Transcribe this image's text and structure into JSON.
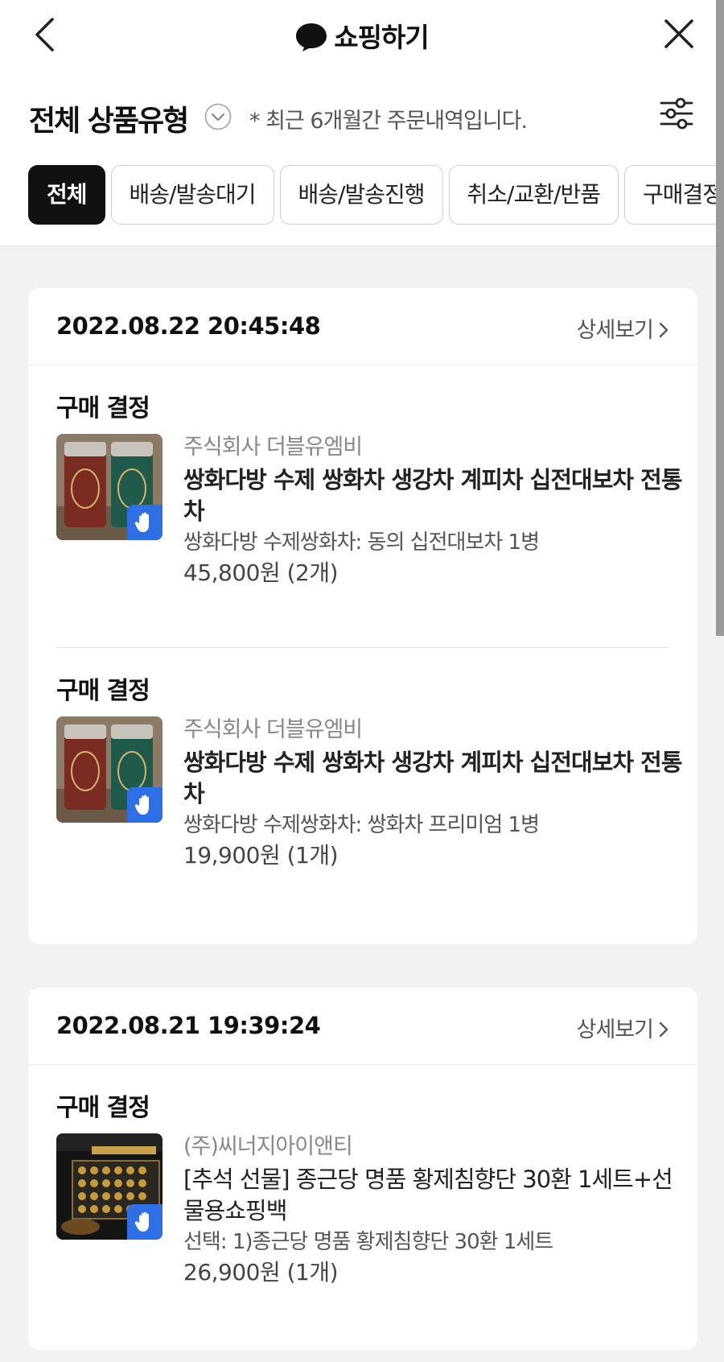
{
  "header": {
    "title": "쇼핑하기",
    "back_icon": "chevron-left-icon",
    "close_icon": "close-icon",
    "chat_icon": "speech-bubble-icon"
  },
  "filter": {
    "type_label": "전체 상품유형",
    "note": "* 최근 6개월간 주문내역입니다.",
    "settings_icon": "sliders-icon"
  },
  "chips": [
    "전체",
    "배송/발송대기",
    "배송/발송진행",
    "취소/교환/반품",
    "구매결정"
  ],
  "orders": [
    {
      "date": "2022.08.22 20:45:48",
      "detail_label": "상세보기",
      "items": [
        {
          "status": "구매 결정",
          "seller": "주식회사 더블유엠비",
          "name": "쌍화다방 수제 쌍화차 생강차 계피차 십전대보차 전통차",
          "option": "쌍화다방 수제쌍화차: 동의 십전대보차 1병",
          "price": "45,800원 (2개)"
        },
        {
          "status": "구매 결정",
          "seller": "주식회사 더블유엠비",
          "name": "쌍화다방 수제 쌍화차 생강차 계피차 십전대보차 전통차",
          "option": "쌍화다방 수제쌍화차: 쌍화차 프리미엄 1병",
          "price": "19,900원 (1개)"
        }
      ]
    },
    {
      "date": "2022.08.21 19:39:24",
      "detail_label": "상세보기",
      "items": [
        {
          "status": "구매 결정",
          "seller": "(주)씨너지아이앤티",
          "name": "[추석 선물] 종근당 명품 황제침향단 30환 1세트+선물용쇼핑백",
          "option": "선택: 1)종근당 명품 황제침향단 30환 1세트",
          "price": "26,900원 (1개)"
        }
      ]
    }
  ],
  "colors": {
    "badge": "#2f6fe6",
    "active_chip": "#111111",
    "background": "#f2f2f2"
  }
}
